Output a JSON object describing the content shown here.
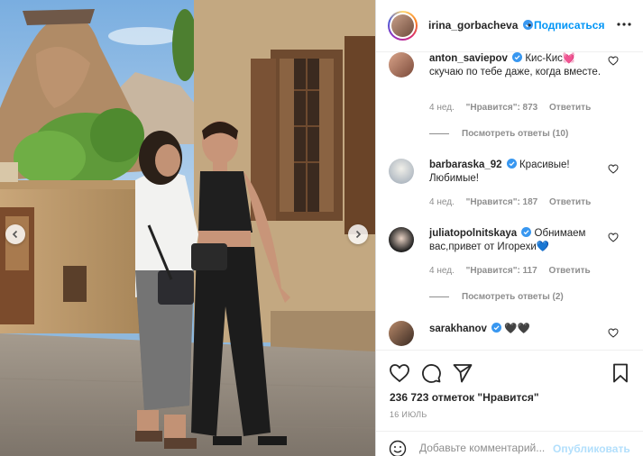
{
  "post": {
    "author": "irina_gorbacheva",
    "follow_label": "Подписаться",
    "separator": "•",
    "likes_text": "236 723 отметок \"Нравится\"",
    "date": "16 ИЮЛЬ",
    "comment_placeholder": "Добавьте комментарий...",
    "post_label": "Опубликовать"
  },
  "comments": [
    {
      "username": "anton_saviepov",
      "text": "Кис-Кис💓 скучаю по тебе даже, когда вместе.",
      "time": "4 нед.",
      "likes": "\"Нравится\": 873",
      "reply": "Ответить"
    },
    {
      "username": "barbaraska_92",
      "text": "Красивые! Любимые!",
      "time": "4 нед.",
      "likes": "\"Нравится\": 187",
      "reply": "Ответить"
    },
    {
      "username": "juliatopolnitskaya",
      "text": "Обнимаем вас,привет от Игорехи💙",
      "time": "4 нед.",
      "likes": "\"Нравится\": 117",
      "reply": "Ответить"
    },
    {
      "username": "sarakhanov",
      "text": "🖤🖤",
      "time": "",
      "likes": "",
      "reply": ""
    }
  ],
  "replies": [
    {
      "label": "Посмотреть ответы (10)"
    },
    {
      "label": "Посмотреть ответы (2)"
    }
  ],
  "colors": {
    "accent": "#0095f6",
    "verified": "#3897f0",
    "muted": "#8e8e8e",
    "text": "#262626"
  },
  "icons": {
    "header_more": "more-horizontal-icon",
    "like": "heart-outline-icon",
    "comment": "comment-icon",
    "share": "paper-plane-icon",
    "save": "bookmark-icon",
    "emoji": "smiley-icon",
    "nav_prev": "chevron-left-icon",
    "nav_next": "chevron-right-icon"
  }
}
